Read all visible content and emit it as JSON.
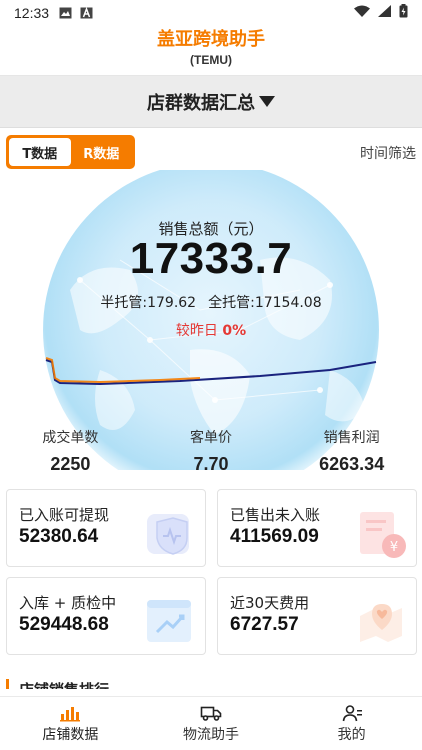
{
  "status_bar": {
    "time": "12:33",
    "left_icons": [
      "image-icon",
      "font-icon"
    ],
    "right_icons": [
      "wifi-icon",
      "signal-icon",
      "battery-icon"
    ]
  },
  "header": {
    "title": "盖亚跨境助手",
    "subtitle": "(TEMU)"
  },
  "group_selector": {
    "label": "店群数据汇总"
  },
  "data_toggle": {
    "options": [
      "T数据",
      "R数据"
    ],
    "selected": "T数据"
  },
  "time_filter": "时间筛选",
  "sales": {
    "label": "销售总额（元）",
    "total": "17333.7",
    "semi_label": "半托管:",
    "semi_value": "179.62",
    "full_label": "全托管:",
    "full_value": "17154.08",
    "compare_label": "较昨日",
    "compare_value": "0%"
  },
  "stats": [
    {
      "label": "成交单数",
      "value": "2250"
    },
    {
      "label": "客单价",
      "value": "7.70"
    },
    {
      "label": "销售利润",
      "value": "6263.34"
    }
  ],
  "cards": [
    {
      "label": "已入账可提现",
      "value": "52380.64",
      "icon": "shield-icon"
    },
    {
      "label": "已售出未入账",
      "value": "411569.09",
      "icon": "receipt-yen-icon"
    },
    {
      "label": "入库 + 质检中",
      "value": "529448.68",
      "icon": "chart-trend-icon"
    },
    {
      "label": "近30天费用",
      "value": "6727.57",
      "icon": "location-fee-icon"
    }
  ],
  "section_title_peek": "店铺销售排行",
  "bottom_nav": [
    {
      "label": "店铺数据",
      "icon": "bar-chart-icon",
      "active": true
    },
    {
      "label": "物流助手",
      "icon": "truck-icon",
      "active": false
    },
    {
      "label": "我的",
      "icon": "user-icon",
      "active": false
    }
  ],
  "colors": {
    "accent": "#f57c00",
    "negative_compare": "#e53935",
    "trend_blue": "#1a237e",
    "trend_orange": "#f57c00"
  }
}
